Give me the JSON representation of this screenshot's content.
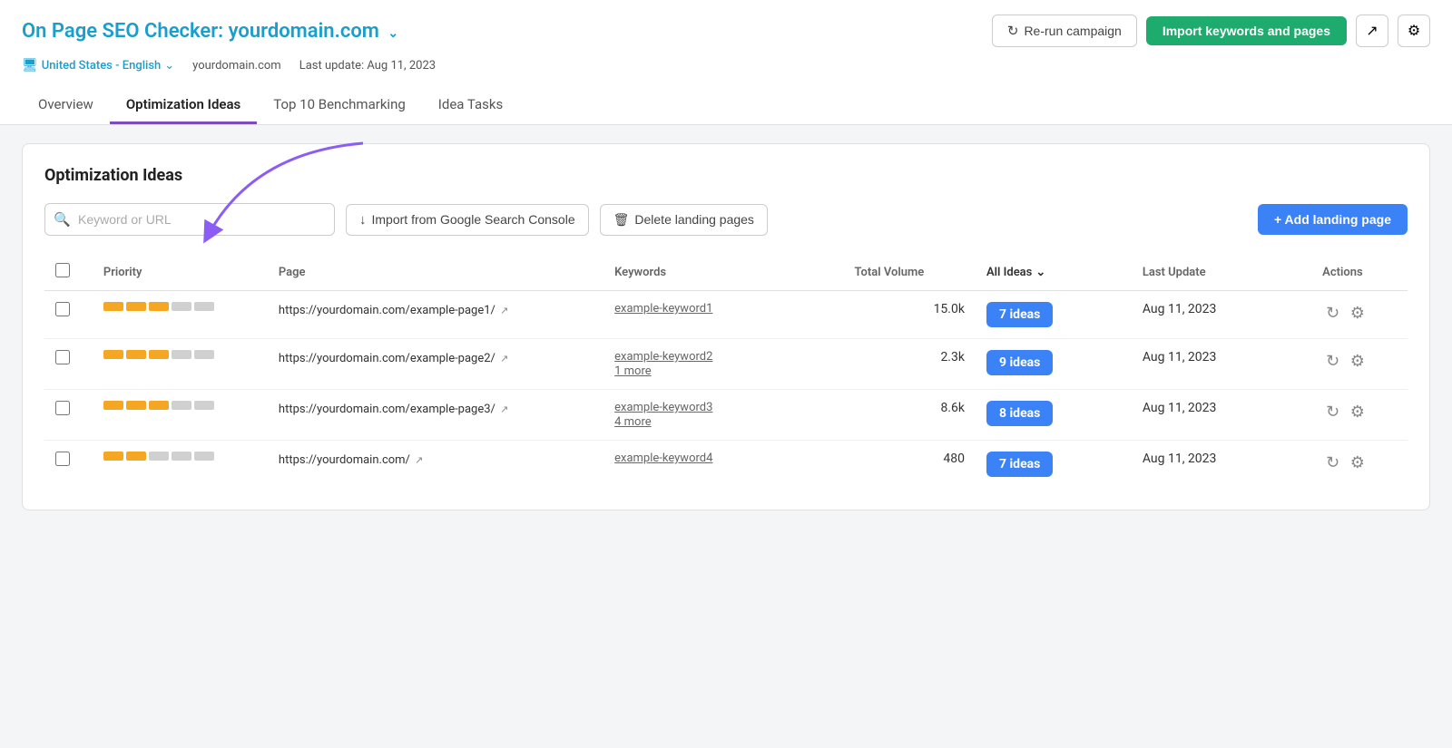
{
  "header": {
    "title_prefix": "On Page SEO Checker:",
    "domain": "yourdomain.com",
    "meta_locale": "United States - English",
    "meta_domain": "yourdomain.com",
    "meta_lastupdate": "Last update: Aug 11, 2023",
    "btn_rerun": "Re-run campaign",
    "btn_import": "Import keywords and pages"
  },
  "tabs": [
    {
      "id": "overview",
      "label": "Overview"
    },
    {
      "id": "optimization-ideas",
      "label": "Optimization Ideas",
      "active": true
    },
    {
      "id": "top10",
      "label": "Top 10 Benchmarking"
    },
    {
      "id": "idea-tasks",
      "label": "Idea Tasks"
    }
  ],
  "main": {
    "card_title": "Optimization Ideas",
    "search_placeholder": "Keyword or URL",
    "btn_import_console": "Import from Google Search Console",
    "btn_delete": "Delete landing pages",
    "btn_add": "+ Add landing page",
    "all_ideas_label": "All Ideas",
    "table_headers": {
      "priority": "Priority",
      "page": "Page",
      "keywords": "Keywords",
      "total_volume": "Total Volume",
      "all_ideas": "All Ideas",
      "last_update": "Last Update",
      "actions": "Actions"
    },
    "rows": [
      {
        "id": 1,
        "priority_bars": [
          3,
          0
        ],
        "page": "https://yourdomain.com/example-page1/",
        "keywords": [
          "example-keyword1"
        ],
        "more_keywords": null,
        "volume": "15.0k",
        "ideas_count": "7 ideas",
        "last_update": "Aug 11, 2023"
      },
      {
        "id": 2,
        "priority_bars": [
          3,
          0
        ],
        "page": "https://yourdomain.com/example-page2/",
        "keywords": [
          "example-keyword2"
        ],
        "more_keywords": "1 more",
        "volume": "2.3k",
        "ideas_count": "9 ideas",
        "last_update": "Aug 11, 2023"
      },
      {
        "id": 3,
        "priority_bars": [
          3,
          0
        ],
        "page": "https://yourdomain.com/example-page3/",
        "keywords": [
          "example-keyword3"
        ],
        "more_keywords": "4 more",
        "volume": "8.6k",
        "ideas_count": "8 ideas",
        "last_update": "Aug 11, 2023"
      },
      {
        "id": 4,
        "priority_bars": [
          2,
          1
        ],
        "page": "https://yourdomain.com/",
        "keywords": [
          "example-keyword4"
        ],
        "more_keywords": null,
        "volume": "480",
        "ideas_count": "7 ideas",
        "last_update": "Aug 11, 2023"
      }
    ]
  }
}
